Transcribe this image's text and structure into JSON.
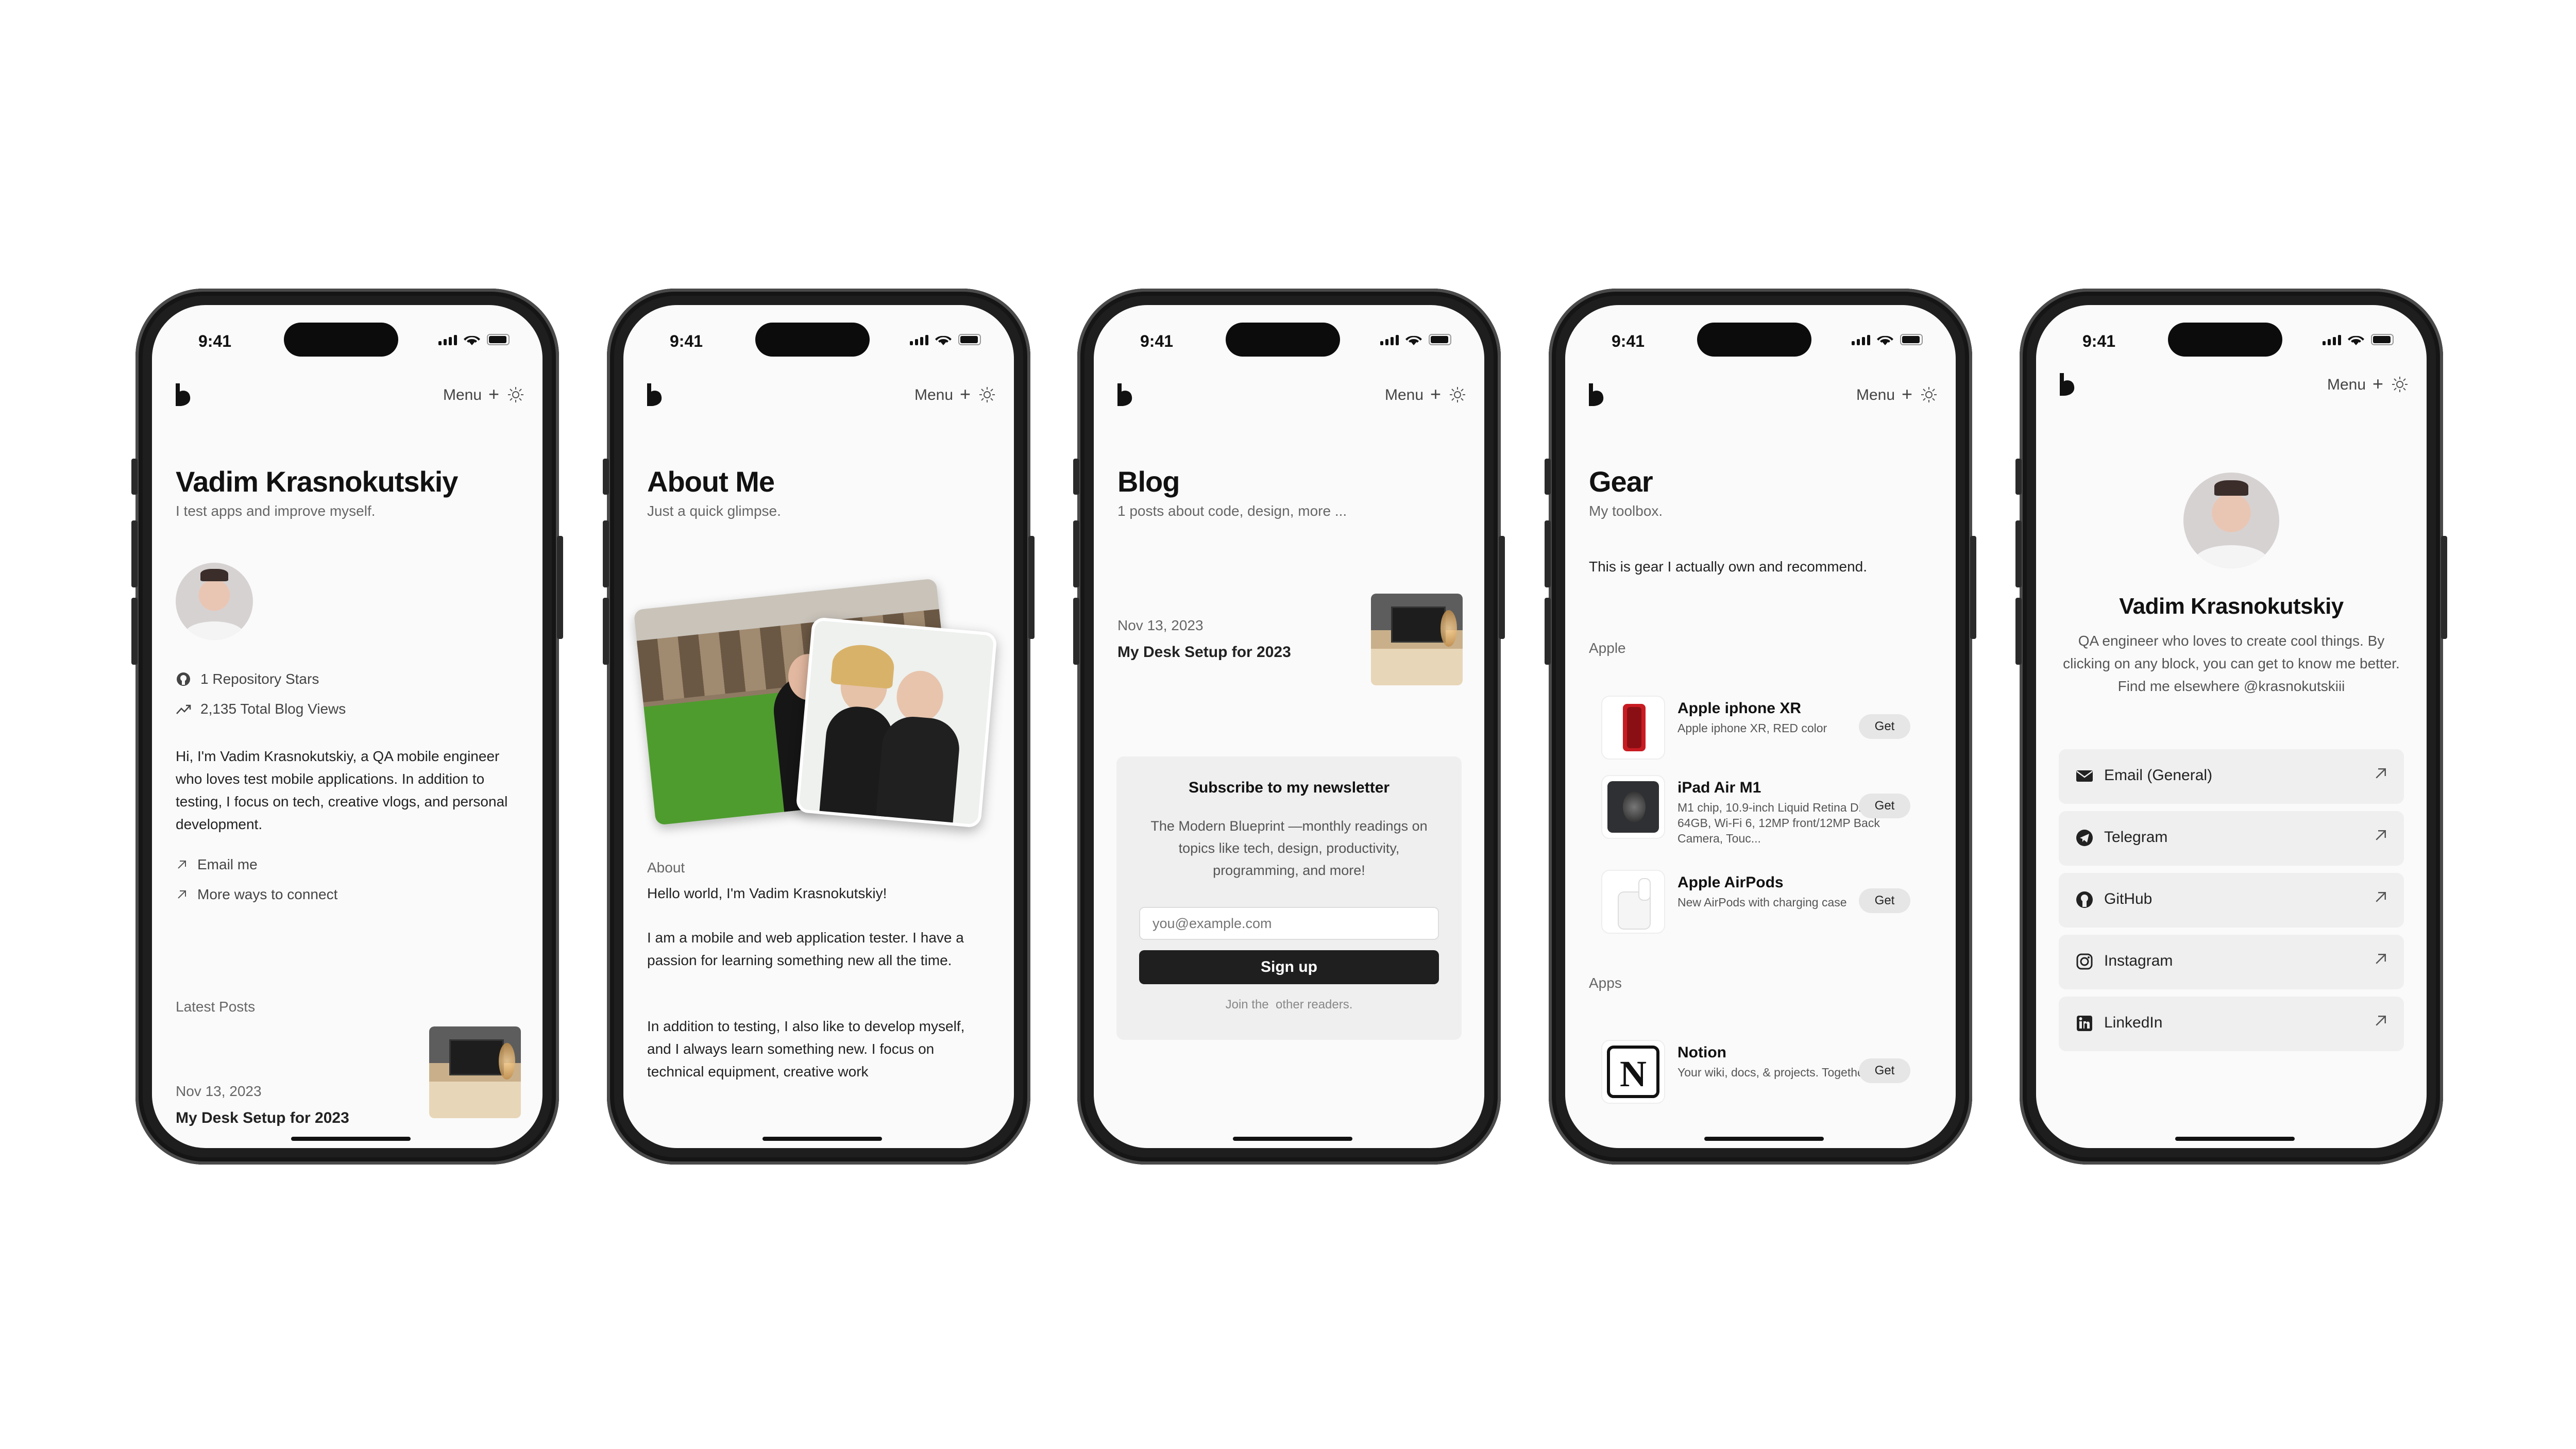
{
  "status": {
    "time": "9:41"
  },
  "nav": {
    "menu": "Menu",
    "plus": "+"
  },
  "home": {
    "name": "Vadim Krasnokutskiy",
    "tagline": "I test apps and improve myself.",
    "stars": "1 Repository Stars",
    "views": "2,135 Total Blog Views",
    "bio": "Hi, I'm Vadim Krasnokutskiy, a QA mobile engineer who loves test mobile applications. In addition to testing, I focus on tech, creative vlogs, and personal development.",
    "email": "Email me",
    "more": "More ways to connect",
    "latest": "Latest Posts",
    "post_date": "Nov 13, 2023",
    "post_title": "My Desk Setup for 2023"
  },
  "about": {
    "title": "About Me",
    "subtitle": "Just a quick glimpse.",
    "section": "About",
    "p1": "Hello world, I'm Vadim Krasnokutskiy!",
    "p2": "I am a mobile and web application tester. I have a passion for learning something new all the time.",
    "p3": "In addition to testing, I also like to develop myself, and I always learn something new. I focus on technical equipment, creative work"
  },
  "blog": {
    "title": "Blog",
    "subtitle": "1 posts about code, design, more ...",
    "post_date": "Nov 13, 2023",
    "post_title": "My Desk Setup for 2023",
    "newsletter_title": "Subscribe to my newsletter",
    "newsletter_desc": "The Modern Blueprint —monthly readings on topics like tech, design, productivity, programming, and more!",
    "email_placeholder": "you@example.com",
    "signup": "Sign up",
    "readers": "Join the  other readers."
  },
  "gear": {
    "title": "Gear",
    "subtitle": "My toolbox.",
    "intro": "This is gear I actually own and recommend.",
    "cat_apple": "Apple",
    "cat_apps": "Apps",
    "get": "Get",
    "items": [
      {
        "title": "Apple iphone XR",
        "desc": "Apple iphone XR, RED color"
      },
      {
        "title": "iPad Air M1",
        "desc": "M1 chip, 10.9-inch Liquid Retina Display, 64GB, Wi-Fi 6, 12MP front/12MP Back Camera, Touc..."
      },
      {
        "title": "Apple AirPods",
        "desc": "New AirPods with charging case"
      },
      {
        "title": "Notion",
        "desc": "Your wiki, docs, & projects. Together."
      }
    ]
  },
  "contact": {
    "name": "Vadim Krasnokutskiy",
    "bio": "QA engineer who loves to create cool things. By clicking on any block, you can get to know me better. Find me elsewhere @krasnokutskiii",
    "links": [
      {
        "label": "Email (General)",
        "icon": "mail-icon"
      },
      {
        "label": "Telegram",
        "icon": "telegram-icon"
      },
      {
        "label": "GitHub",
        "icon": "github-icon"
      },
      {
        "label": "Instagram",
        "icon": "instagram-icon"
      },
      {
        "label": "LinkedIn",
        "icon": "linkedin-icon"
      }
    ]
  },
  "colors": {
    "screen_bg": "#fafafa",
    "card_bg": "#efefef",
    "button_dark": "#1f1f1f",
    "frame": "#1e1e1e"
  }
}
